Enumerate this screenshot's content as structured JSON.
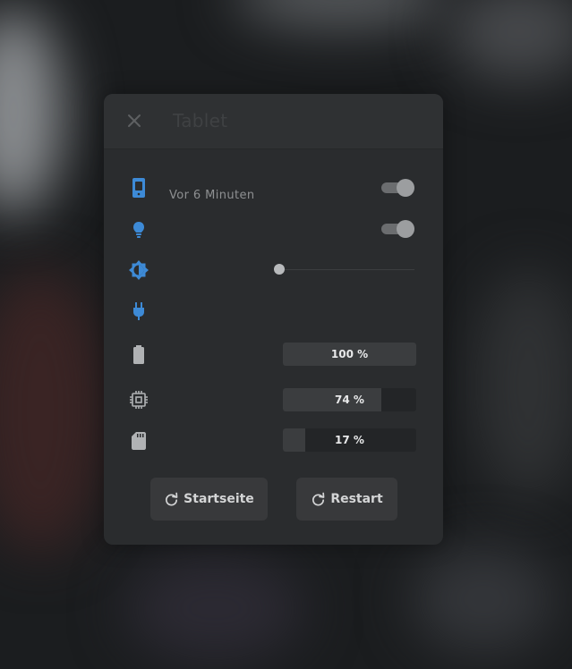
{
  "dialog": {
    "title": "Tablet"
  },
  "rows": {
    "last_seen": {
      "value": "Vor 6 Minuten",
      "toggle_on": true
    },
    "screen": {
      "toggle_on": true
    },
    "brightness": {
      "level": 0.05
    },
    "battery": {
      "percent": 1.0,
      "label": "100 %"
    },
    "ram": {
      "percent": 0.74,
      "label": "74 %"
    },
    "storage": {
      "percent": 0.17,
      "label": "17 %"
    }
  },
  "buttons": {
    "home": "Startseite",
    "restart": "Restart"
  },
  "colors": {
    "accent": "#3d8ad6"
  },
  "icons": [
    "close-icon",
    "tablet-icon",
    "lightbulb-icon",
    "brightness-icon",
    "plug-icon",
    "battery-icon",
    "chip-icon",
    "sd-card-icon",
    "restart-icon"
  ]
}
